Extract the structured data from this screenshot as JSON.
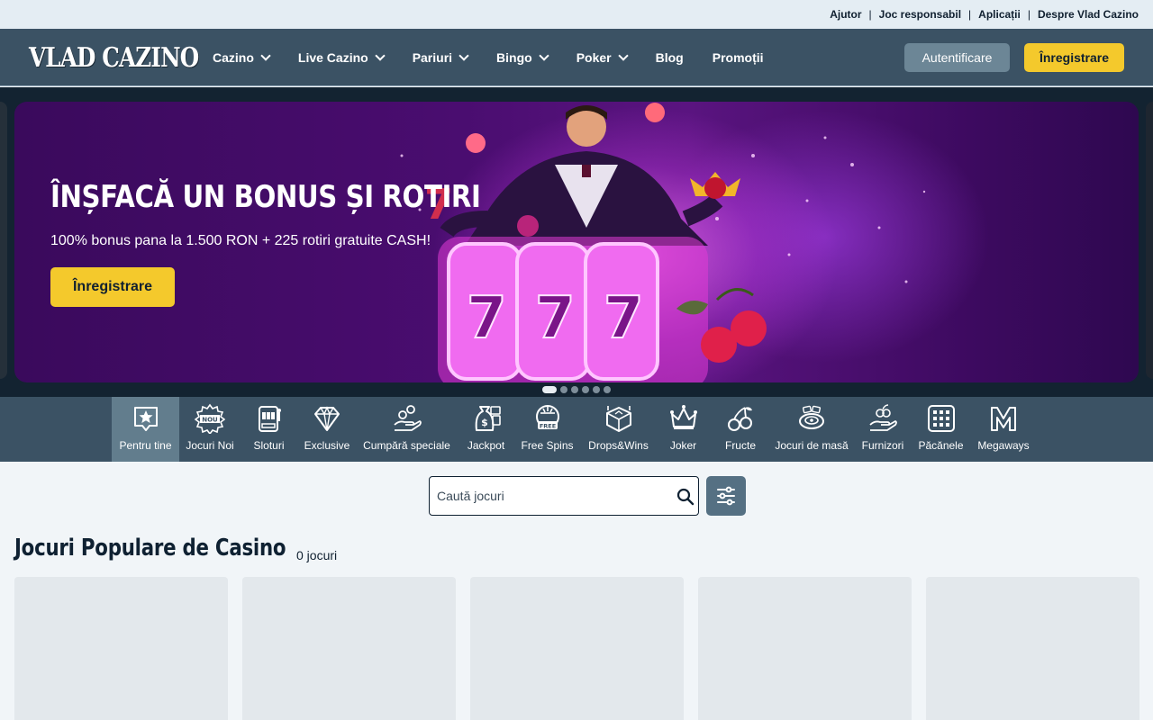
{
  "topbar": {
    "links": [
      "Ajutor",
      "Joc responsabil",
      "Aplicații",
      "Despre Vlad Cazino"
    ],
    "separator": "|"
  },
  "header": {
    "logo_text": "VLAD CAZINO",
    "nav": [
      {
        "label": "Cazino",
        "has_dropdown": true
      },
      {
        "label": "Live Cazino",
        "has_dropdown": true
      },
      {
        "label": "Pariuri",
        "has_dropdown": true
      },
      {
        "label": "Bingo",
        "has_dropdown": true
      },
      {
        "label": "Poker",
        "has_dropdown": true
      },
      {
        "label": "Blog",
        "has_dropdown": false
      },
      {
        "label": "Promoții",
        "has_dropdown": false
      }
    ],
    "login_label": "Autentificare",
    "register_label": "Înregistrare"
  },
  "hero": {
    "title": "ÎNȘFACĂ UN BONUS ȘI ROTIRI",
    "subtitle": "100% bonus pana la 1.500 RON + 225 rotiri gratuite CASH!",
    "cta_label": "Înregistrare",
    "slides": 6,
    "active_slide": 1
  },
  "categories": [
    {
      "label": "Pentru tine",
      "icon": "star-badge-icon",
      "active": true
    },
    {
      "label": "Jocuri Noi",
      "icon": "new-badge-icon",
      "badge_text": "NOU"
    },
    {
      "label": "Sloturi",
      "icon": "slot-machine-icon"
    },
    {
      "label": "Exclusive",
      "icon": "diamond-icon"
    },
    {
      "label": "Cumpără speciale",
      "icon": "coins-hand-icon"
    },
    {
      "label": "Jackpot",
      "icon": "money-bag-icon"
    },
    {
      "label": "Free Spins",
      "icon": "free-spins-icon",
      "badge_text": "FREE"
    },
    {
      "label": "Drops&Wins",
      "icon": "gift-box-icon"
    },
    {
      "label": "Joker",
      "icon": "jester-hat-icon"
    },
    {
      "label": "Fructe",
      "icon": "cherries-icon"
    },
    {
      "label": "Jocuri de masă",
      "icon": "roulette-icon"
    },
    {
      "label": "Furnizori",
      "icon": "provider-hand-icon"
    },
    {
      "label": "Păcănele",
      "icon": "grid-icon"
    },
    {
      "label": "Megaways",
      "icon": "megaways-icon"
    }
  ],
  "search": {
    "placeholder": "Caută jocuri",
    "value": ""
  },
  "section": {
    "title": "Jocuri Populare de Casino",
    "count_label": "0 jocuri"
  },
  "colors": {
    "header_bg": "#3b5264",
    "accent_yellow": "#f4c92c",
    "topbar_bg": "#e4edf3",
    "page_bg": "#f1f5f8",
    "card_placeholder": "#e3e8ec"
  }
}
